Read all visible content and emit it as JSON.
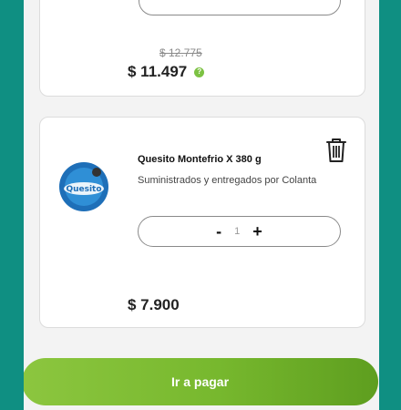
{
  "cart": {
    "previous_item": {
      "old_price": "$ 12.775",
      "price": "$ 11.497",
      "info_icon": "info-icon"
    },
    "item": {
      "title": "Quesito Montefrio X 380 g",
      "supplier": "Suministrados y entregados por Colanta",
      "quantity": "1",
      "minus_label": "-",
      "plus_label": "+",
      "price": "$ 7.900",
      "image_text": "Quesito"
    }
  },
  "checkout": {
    "button_label": "Ir a pagar"
  },
  "colors": {
    "background": "#0f8f82",
    "accent": "#7cc243"
  }
}
